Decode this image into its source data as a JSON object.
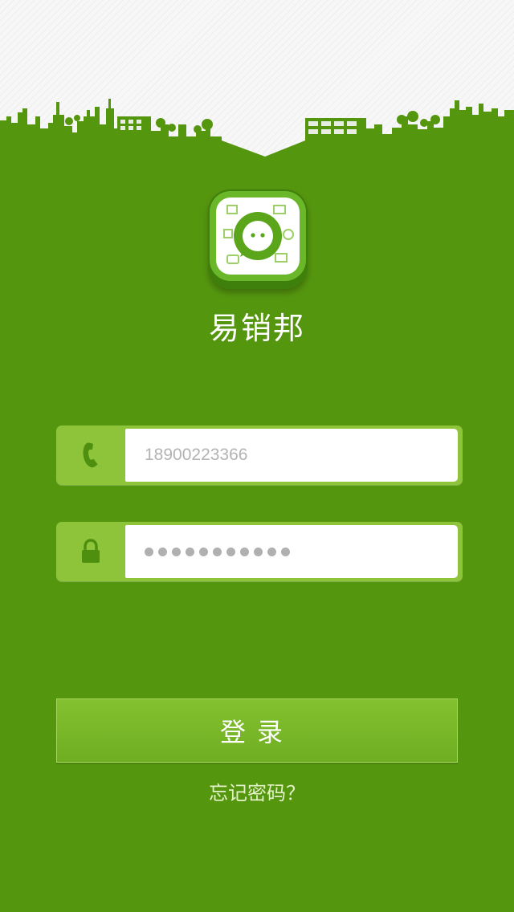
{
  "colors": {
    "background": "#55960f",
    "accent_light": "#8dc43a",
    "button": "#7ab92a",
    "sky": "#f7f7f7"
  },
  "app": {
    "name": "易销邦",
    "icon": "chat-bubble-app-icon"
  },
  "form": {
    "phone": {
      "icon": "phone-icon",
      "placeholder": "18900223366",
      "value": ""
    },
    "password": {
      "icon": "lock-icon",
      "masked_length": 11
    }
  },
  "actions": {
    "login_label": "登录",
    "forgot_label": "忘记密码？"
  }
}
